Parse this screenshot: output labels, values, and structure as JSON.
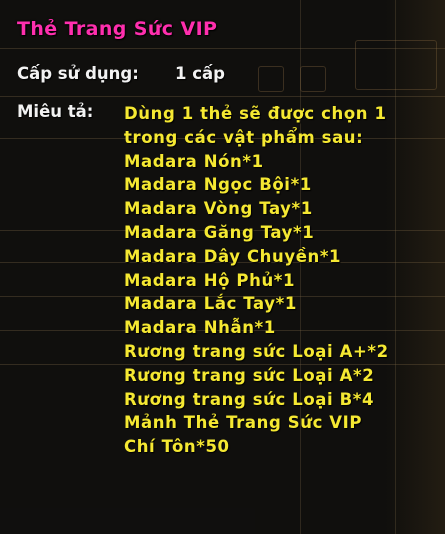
{
  "tooltip": {
    "title": "Thẻ Trang Sức VIP",
    "level": {
      "label": "Cấp sử dụng:",
      "value": "1 cấp"
    },
    "description": {
      "label": "Miêu tả:",
      "intro_lines": [
        "Dùng 1 thẻ sẽ được chọn 1",
        "trong các vật phẩm sau:"
      ],
      "items": [
        "Madara Nón*1",
        "Madara Ngọc Bội*1",
        "Madara Vòng Tay*1",
        "Madara Găng Tay*1",
        "Madara Dây Chuyền*1",
        "Madara Hộ Phủ*1",
        "Madara Lắc Tay*1",
        "Madara Nhẫn*1",
        "Rương trang sức Loại A+*2",
        "Rương trang sức Loại A*2",
        "Rương trang sức Loại B*4",
        "Mảnh Thẻ Trang Sức VIP",
        "Chí Tôn*50"
      ]
    }
  },
  "colors": {
    "title": "#ff2fae",
    "label": "#f2f2f2",
    "description": "#f5e832",
    "panel_background": "#0c0c0c"
  }
}
